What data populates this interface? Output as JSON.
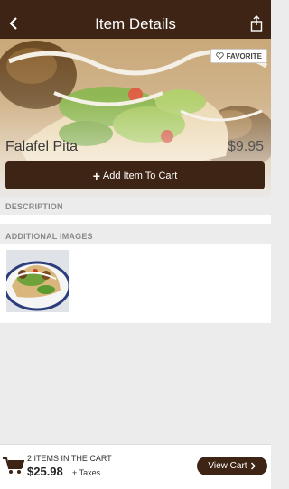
{
  "header": {
    "title": "Item Details",
    "back_icon": "chevron-left-icon",
    "share_icon": "share-icon"
  },
  "item": {
    "name": "Falafel Pita",
    "price": "$9.95",
    "favorite_label": "FAVORITE",
    "add_to_cart_label": "Add Item To Cart"
  },
  "sections": {
    "description_label": "DESCRIPTION",
    "additional_images_label": "ADDITIONAL IMAGES"
  },
  "cart": {
    "items_label": "2 ITEMS IN THE CART",
    "total": "$25.98",
    "taxes_label": "+ Taxes",
    "view_cart_label": "View Cart"
  },
  "colors": {
    "brand": "#3d2414",
    "background": "#ececec"
  }
}
